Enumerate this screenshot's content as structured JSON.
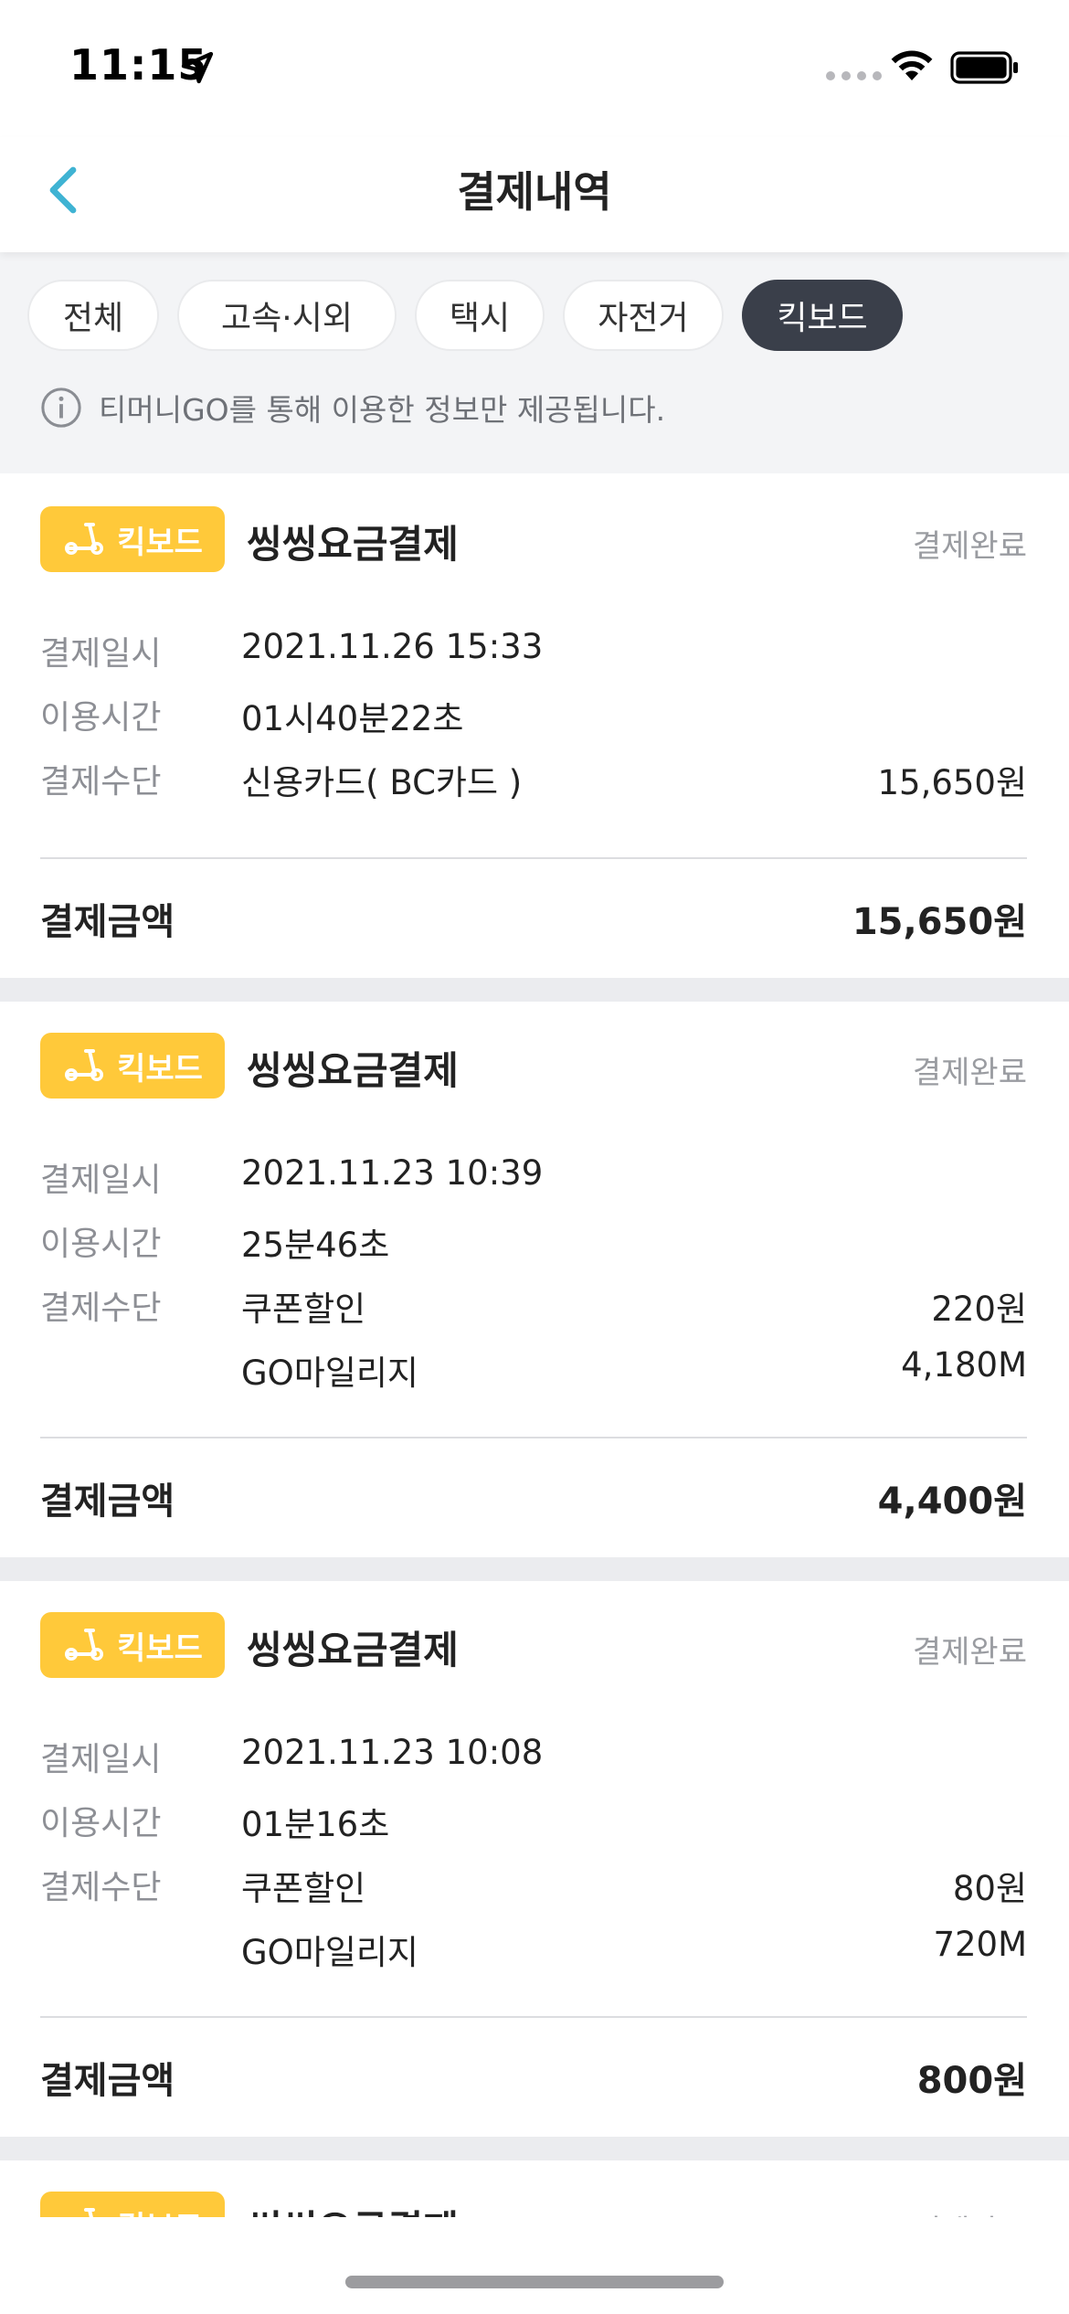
{
  "status_bar": {
    "time": "11:15"
  },
  "nav": {
    "title": "결제내역"
  },
  "filters": [
    {
      "label": "전체",
      "active": false
    },
    {
      "label": "고속·시외",
      "active": false
    },
    {
      "label": "택시",
      "active": false
    },
    {
      "label": "자전거",
      "active": false
    },
    {
      "label": "킥보드",
      "active": true
    }
  ],
  "notice": "티머니GO를 통해 이용한 정보만 제공됩니다.",
  "labels": {
    "badge": "킥보드",
    "date": "결제일시",
    "duration": "이용시간",
    "method": "결제수단",
    "total": "결제금액"
  },
  "payments": [
    {
      "title": "씽씽요금결제",
      "status": "결제완료",
      "date": "2021.11.26 15:33",
      "duration": "01시40분22초",
      "methods": [
        {
          "name": "신용카드( BC카드 )",
          "amount": "15,650원"
        }
      ],
      "total": "15,650원"
    },
    {
      "title": "씽씽요금결제",
      "status": "결제완료",
      "date": "2021.11.23 10:39",
      "duration": "25분46초",
      "methods": [
        {
          "name": "쿠폰할인",
          "amount": "220원"
        },
        {
          "name": "GO마일리지",
          "amount": "4,180M"
        }
      ],
      "total": "4,400원"
    },
    {
      "title": "씽씽요금결제",
      "status": "결제완료",
      "date": "2021.11.23 10:08",
      "duration": "01분16초",
      "methods": [
        {
          "name": "쿠폰할인",
          "amount": "80원"
        },
        {
          "name": "GO마일리지",
          "amount": "720M"
        }
      ],
      "total": "800원"
    },
    {
      "title": "씽씽요금결제",
      "status": "결제완료"
    }
  ],
  "colors": {
    "accent": "#3fb3d3",
    "badge": "#ffc93a",
    "active_chip": "#3a3f4a"
  }
}
